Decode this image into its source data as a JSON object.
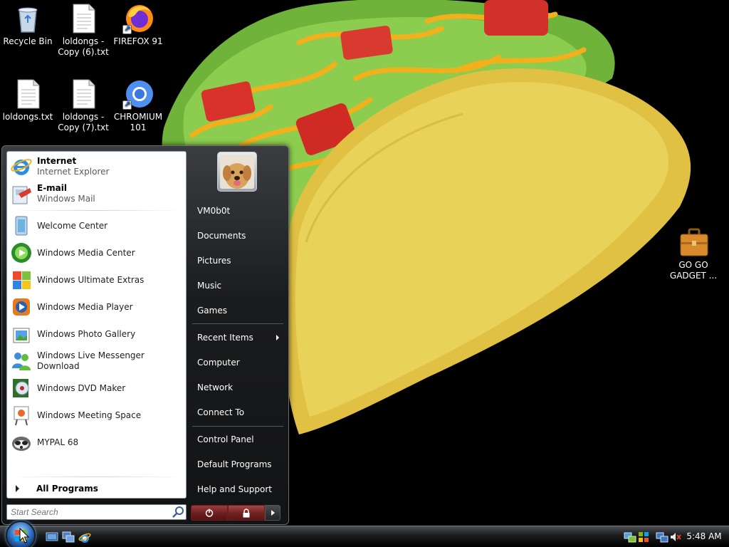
{
  "desktop": {
    "icons": [
      {
        "label": "Recycle Bin"
      },
      {
        "label": "loldongs - Copy (6).txt"
      },
      {
        "label": "FIREFOX 91"
      },
      {
        "label": "loldongs.txt"
      },
      {
        "label": "loldongs - Copy (7).txt"
      },
      {
        "label": "CHROMIUM 101"
      },
      {
        "label": "GO GO GADGET ..."
      }
    ]
  },
  "start_menu": {
    "pinned": [
      {
        "title": "Internet",
        "subtitle": "Internet Explorer",
        "icon": "internet-explorer-icon"
      },
      {
        "title": "E-mail",
        "subtitle": "Windows Mail",
        "icon": "windows-mail-icon"
      }
    ],
    "recent": [
      {
        "label": "Welcome Center",
        "icon": "welcome-center-icon"
      },
      {
        "label": "Windows Media Center",
        "icon": "media-center-icon"
      },
      {
        "label": "Windows Ultimate Extras",
        "icon": "ultimate-extras-icon"
      },
      {
        "label": "Windows Media Player",
        "icon": "media-player-icon"
      },
      {
        "label": "Windows Photo Gallery",
        "icon": "photo-gallery-icon"
      },
      {
        "label": "Windows Live Messenger Download",
        "icon": "messenger-icon"
      },
      {
        "label": "Windows DVD Maker",
        "icon": "dvd-maker-icon"
      },
      {
        "label": "Windows Meeting Space",
        "icon": "meeting-space-icon"
      },
      {
        "label": "MYPAL 68",
        "icon": "mypal-icon"
      }
    ],
    "all_programs": "All Programs",
    "search_placeholder": "Start Search",
    "right": [
      {
        "label": "VM0b0t"
      },
      {
        "label": "Documents"
      },
      {
        "label": "Pictures"
      },
      {
        "label": "Music"
      },
      {
        "label": "Games"
      },
      {
        "label": "Recent Items"
      },
      {
        "label": "Computer"
      },
      {
        "label": "Network"
      },
      {
        "label": "Connect To"
      },
      {
        "label": "Control Panel"
      },
      {
        "label": "Default Programs"
      },
      {
        "label": "Help and Support"
      }
    ]
  },
  "taskbar": {
    "clock": "5:48 AM"
  },
  "colors": {
    "desktop_background": "#000000",
    "start_menu_dark": "#1b1c1e",
    "power_button": "#8a2e2e"
  }
}
